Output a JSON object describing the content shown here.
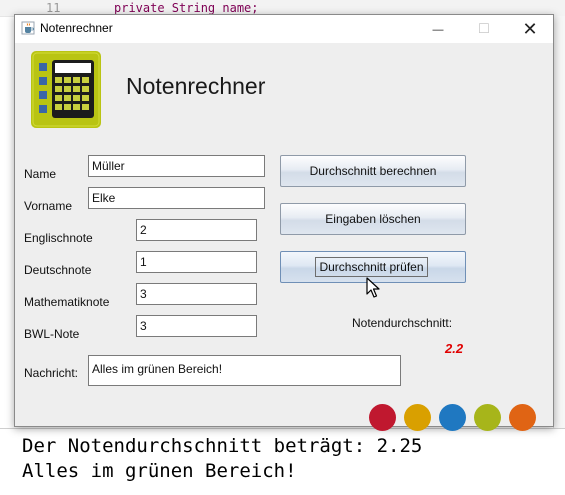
{
  "background_editor": {
    "line_number": "11",
    "code_line": "private String name;"
  },
  "console": {
    "line1": "Der Notendurchschnitt beträgt: 2.25",
    "line2": "Alles im grünen Bereich!"
  },
  "window": {
    "title": "Notenrechner",
    "icon": "java-cup-icon",
    "controls": {
      "minimize": "—",
      "maximize": "□",
      "close": "✕"
    }
  },
  "header": {
    "heading": "Notenrechner",
    "logo": "calculator-icon"
  },
  "form": {
    "name_label": "Name",
    "name_value": "Müller",
    "vorname_label": "Vorname",
    "vorname_value": "Elke",
    "englisch_label": "Englischnote",
    "englisch_value": "2",
    "deutsch_label": "Deutschnote",
    "deutsch_value": "1",
    "mathe_label": "Mathematiknote",
    "mathe_value": "3",
    "bwl_label": "BWL-Note",
    "bwl_value": "3",
    "nachricht_label": "Nachricht:",
    "nachricht_value": "Alles im grünen Bereich!"
  },
  "buttons": {
    "berechnen": "Durchschnitt berechnen",
    "loeschen": "Eingaben löschen",
    "pruefen": "Durchschnitt prüfen"
  },
  "result": {
    "label": "Notendurchschnitt:",
    "value": "2.2",
    "value_color": "#e00000"
  },
  "status_circles": [
    {
      "name": "red-circle",
      "color": "#c0182f"
    },
    {
      "name": "orange-circle",
      "color": "#d9a000"
    },
    {
      "name": "blue-circle",
      "color": "#1f78c1"
    },
    {
      "name": "green-circle",
      "color": "#a7b51a"
    },
    {
      "name": "darkorange-circle",
      "color": "#e06414"
    }
  ]
}
